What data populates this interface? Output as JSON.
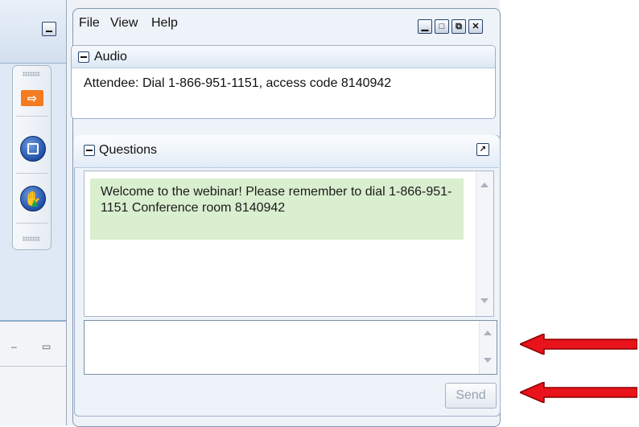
{
  "menu": {
    "items": [
      "File",
      "View",
      "Help"
    ]
  },
  "window_controls": [
    "minimize",
    "restore",
    "maximize",
    "close"
  ],
  "audio": {
    "title": "Audio",
    "text": "Attendee: Dial 1-866-951-1151, access code 8140942"
  },
  "questions": {
    "title": "Questions",
    "messages": [
      "Welcome to the webinar!  Please remember to dial 1-866-951-1151 Conference room 8140942"
    ],
    "input_value": "",
    "send_label": "Send"
  },
  "toolbar_icons": [
    "grab-tab-arrow-icon",
    "stop-broadcast-icon",
    "raise-hand-icon"
  ],
  "colors": {
    "message_background": "#d9efcf",
    "annotation_arrow": "#e8131b",
    "toolbar_arrow": "#f47b1f"
  }
}
